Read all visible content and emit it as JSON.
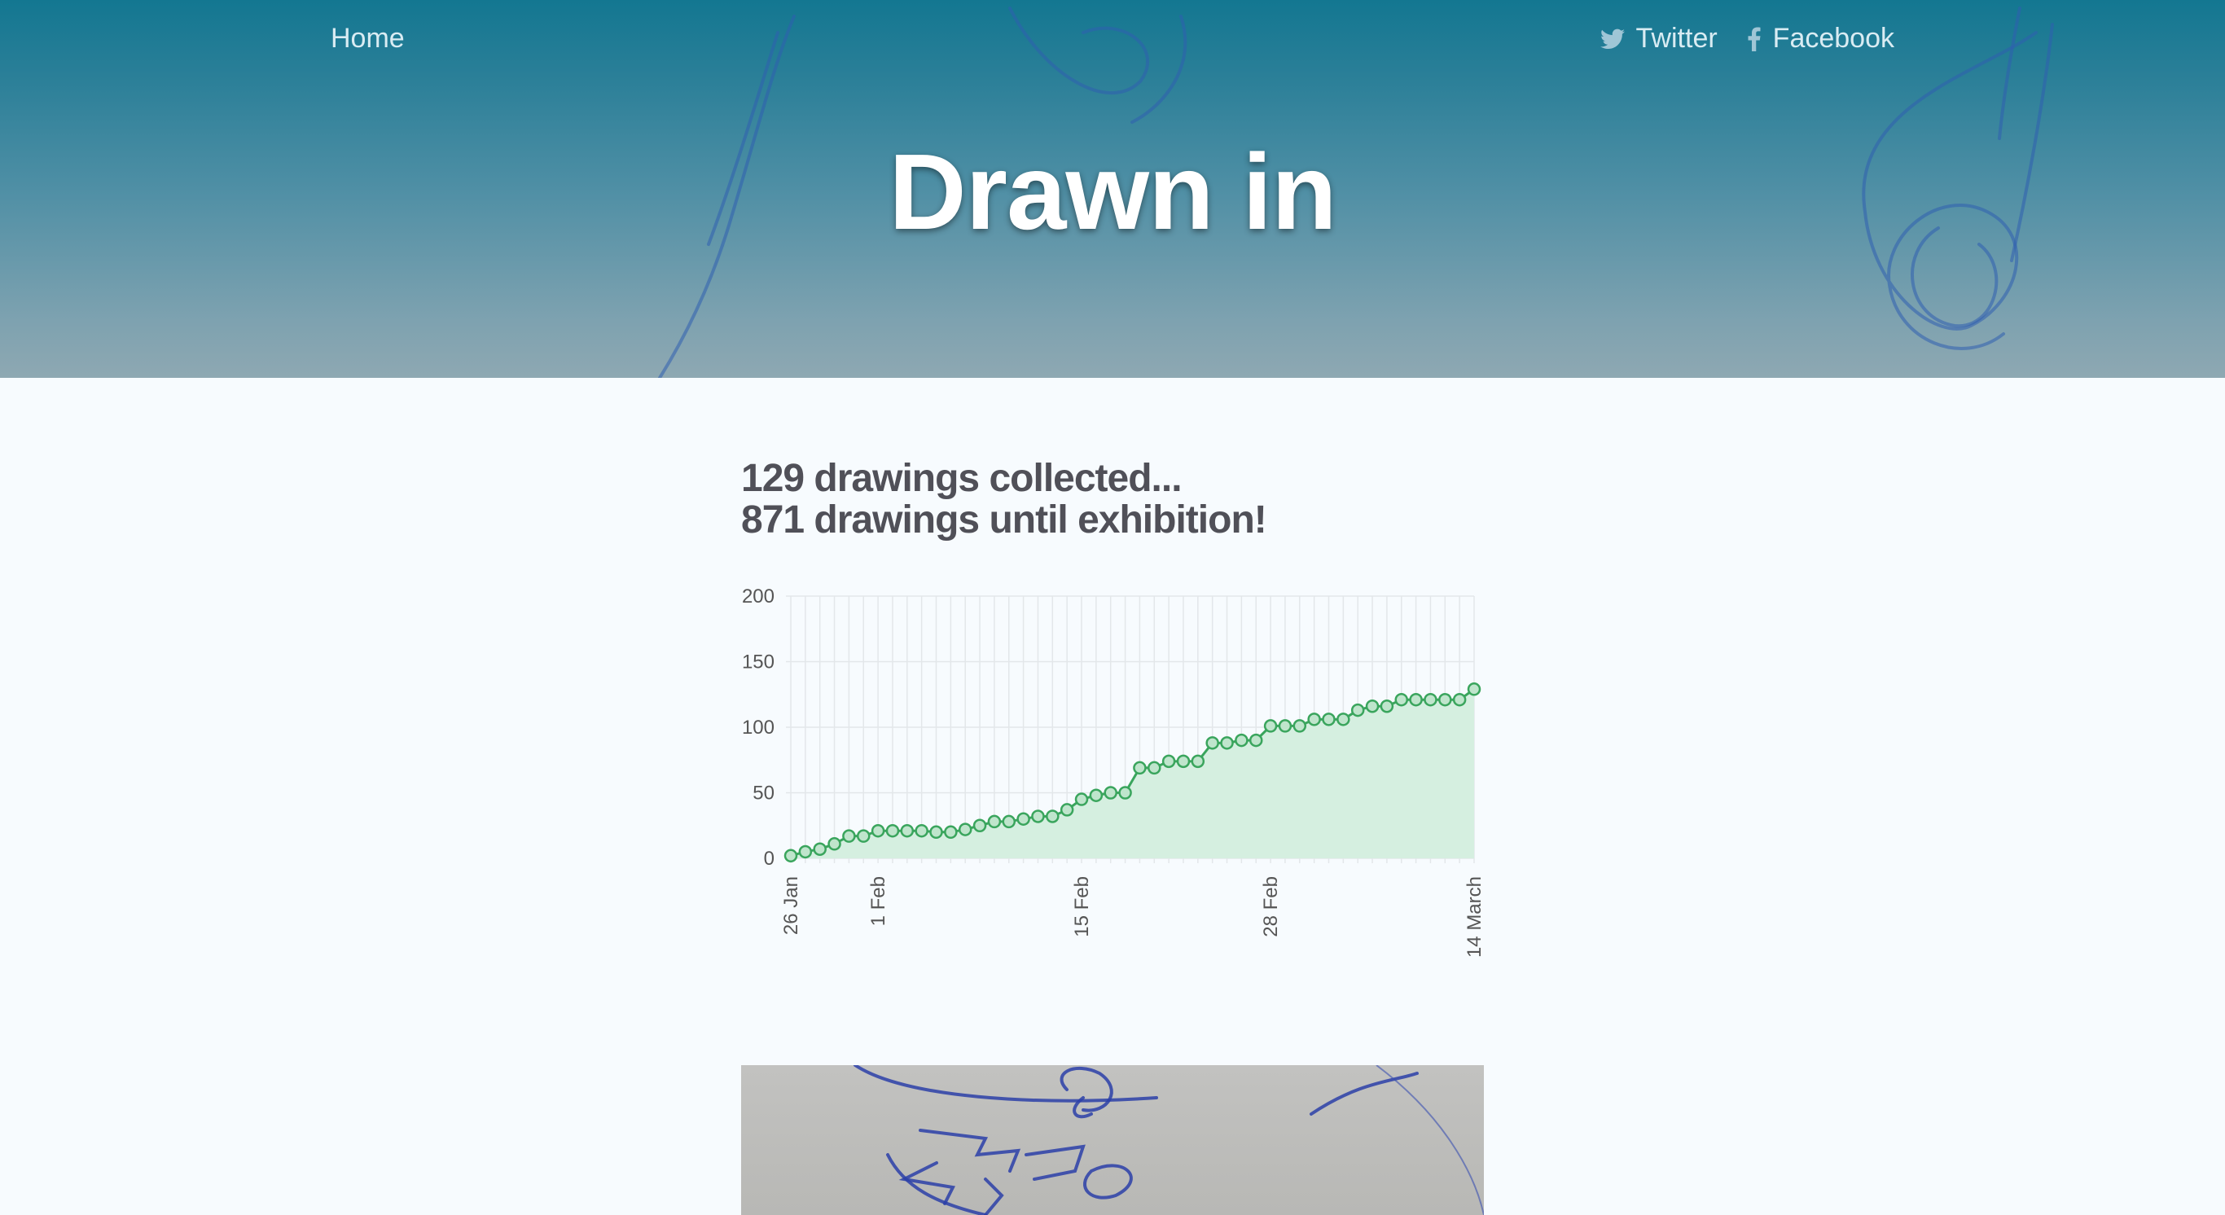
{
  "nav": {
    "home_label": "Home",
    "twitter_label": "Twitter",
    "facebook_label": "Facebook",
    "twitter_icon": "twitter-bird-icon",
    "facebook_icon": "facebook-f-icon"
  },
  "hero": {
    "title": "Drawn in"
  },
  "stats": {
    "collected": "129 drawings collected...",
    "remaining": "871 drawings until exhibition!"
  },
  "colors": {
    "hero_top": "#137791",
    "line": "#3aa55d",
    "fill": "#d5efe0",
    "page_bg": "#f7fbfe"
  },
  "chart_data": {
    "type": "area",
    "title": "",
    "xlabel": "",
    "ylabel": "",
    "ylim": [
      0,
      200
    ],
    "yticks": [
      0,
      50,
      100,
      150,
      200
    ],
    "x_tick_labels": [
      {
        "label": "26 Jan",
        "index": 0
      },
      {
        "label": "1 Feb",
        "index": 6
      },
      {
        "label": "15 Feb",
        "index": 20
      },
      {
        "label": "28 Feb",
        "index": 33
      },
      {
        "label": "14 March",
        "index": 47
      }
    ],
    "grid": true,
    "series": [
      {
        "values": [
          2,
          5,
          7,
          11,
          17,
          17,
          21,
          21,
          21,
          21,
          20,
          20,
          22,
          25,
          28,
          28,
          30,
          32,
          32,
          37,
          45,
          48,
          50,
          50,
          69,
          69,
          74,
          74,
          74,
          88,
          88,
          90,
          90,
          101,
          101,
          101,
          106,
          106,
          106,
          113,
          116,
          116,
          121,
          121,
          121,
          121,
          121,
          129
        ]
      }
    ]
  }
}
